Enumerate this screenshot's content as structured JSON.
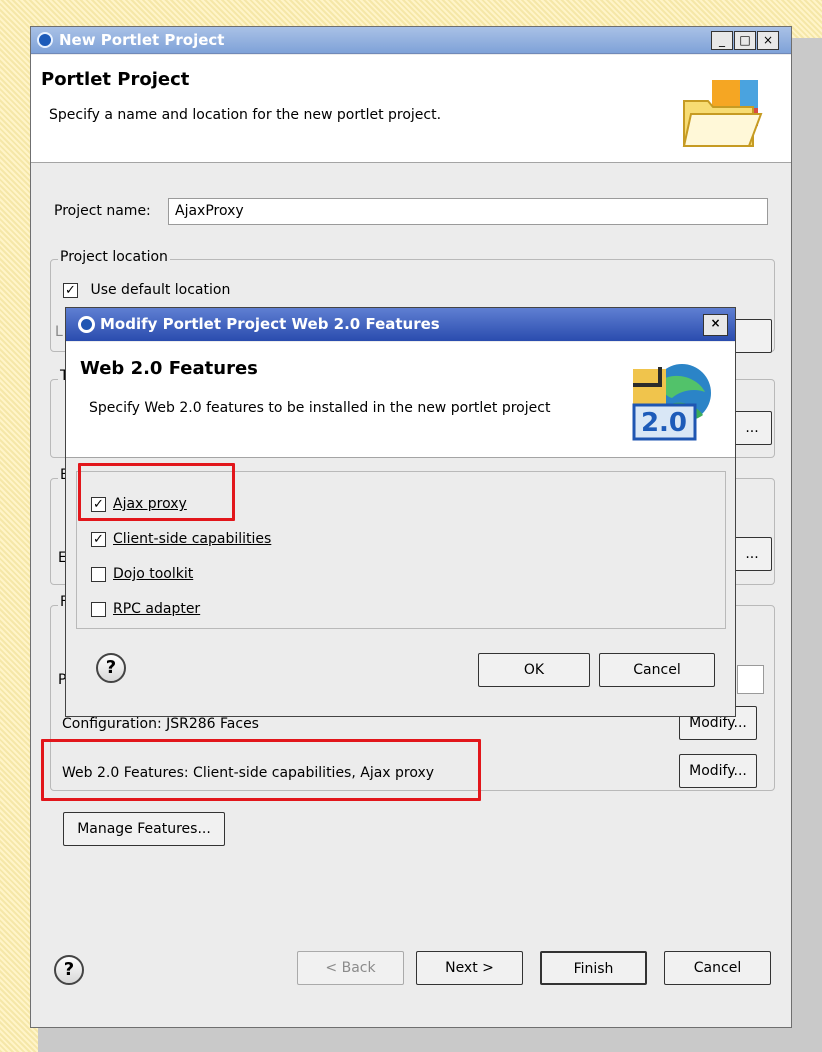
{
  "window": {
    "title": "New Portlet Project",
    "controls": [
      "_",
      "□",
      "×"
    ]
  },
  "header": {
    "title": "Portlet Project",
    "subtitle": "Specify a name and location for the new portlet project."
  },
  "project_name": {
    "label": "Project name:",
    "value": "AjaxProxy"
  },
  "project_location": {
    "group_label": "Project location",
    "use_default_label": "Use default location",
    "use_default_checked": true
  },
  "partial_text": {
    "location_letter": "L",
    "t_group_letter": "T",
    "e_group_letter": "E",
    "e_row_letter": "E",
    "p_group_letter": "F",
    "p_row_letter": "P",
    "ellipsis_btn_1": "...",
    "ellipsis_btn_2": "...",
    "ellipsis_btn_3": "..."
  },
  "configuration": {
    "label": "Configuration: JSR286 Faces",
    "button": "Modify..."
  },
  "web20": {
    "label": "Web 2.0 Features: Client-side capabilities, Ajax proxy",
    "button": "Modify..."
  },
  "manage_features_button": "Manage Features...",
  "footer": {
    "back": "< Back",
    "next": "Next >",
    "finish": "Finish",
    "cancel": "Cancel"
  },
  "modal": {
    "title": "Modify Portlet Project Web 2.0 Features",
    "heading": "Web 2.0 Features",
    "subtitle": "Specify Web 2.0 features to be installed in the new portlet project",
    "icon_label": "2.0",
    "features": [
      {
        "label": "Ajax proxy",
        "checked": true
      },
      {
        "label": "Client-side capabilities",
        "checked": true
      },
      {
        "label": "Dojo toolkit",
        "checked": false
      },
      {
        "label": "RPC adapter",
        "checked": false
      }
    ],
    "ok": "OK",
    "cancel": "Cancel"
  },
  "colors": {
    "highlight_red": "#e2161b",
    "titlebar_blue": "#7fa2d8",
    "modal_title_blue": "#2a4cae"
  }
}
